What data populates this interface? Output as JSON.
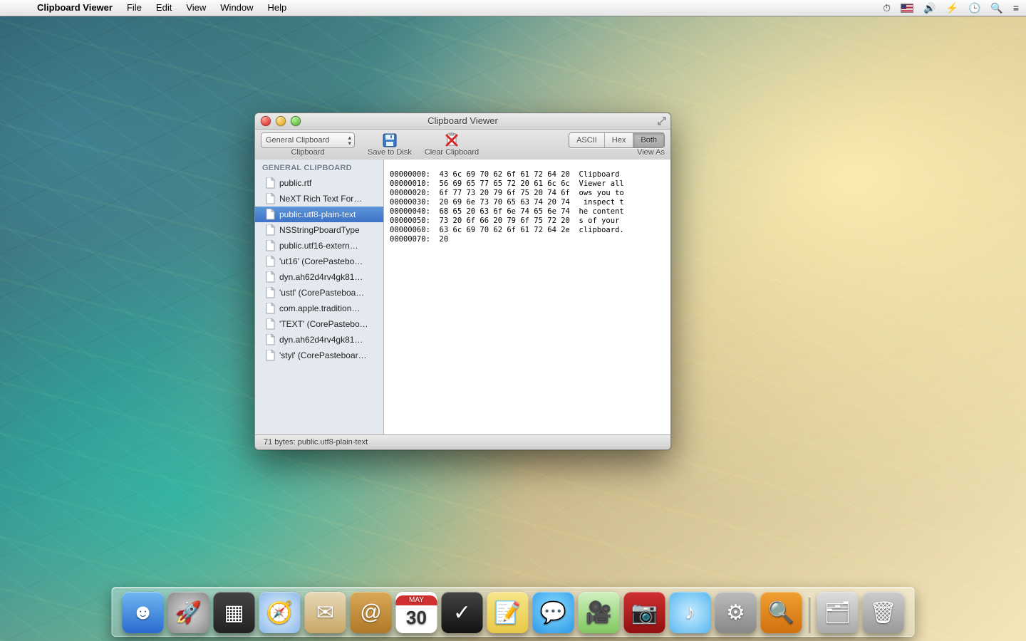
{
  "menubar": {
    "app_name": "Clipboard Viewer",
    "items": [
      "File",
      "Edit",
      "View",
      "Window",
      "Help"
    ],
    "extras": [
      "timer-icon",
      "flag-us",
      "volume-icon",
      "battery-icon",
      "clock-icon",
      "spotlight-icon",
      "notifications-icon"
    ]
  },
  "window": {
    "title": "Clipboard Viewer",
    "toolbar": {
      "clipboard_popup": "General Clipboard",
      "clipboard_label": "Clipboard",
      "save_label": "Save to Disk",
      "clear_label": "Clear Clipboard",
      "viewas_label": "View As",
      "segments": [
        "ASCII",
        "Hex",
        "Both"
      ],
      "segment_selected": 2
    },
    "sidebar": {
      "header": "GENERAL CLIPBOARD",
      "items": [
        "public.rtf",
        "NeXT Rich Text For…",
        "public.utf8-plain-text",
        "NSStringPboardType",
        "public.utf16-extern…",
        "'ut16' (CorePastebo…",
        "dyn.ah62d4rv4gk81…",
        "'ustl' (CorePasteboa…",
        "com.apple.tradition…",
        "'TEXT' (CorePastebo…",
        "dyn.ah62d4rv4gk81…",
        "'styl' (CorePasteboar…"
      ],
      "selected": 2
    },
    "hex_lines": [
      "00000000:  43 6c 69 70 62 6f 61 72 64 20  Clipboard ",
      "00000010:  56 69 65 77 65 72 20 61 6c 6c  Viewer all",
      "00000020:  6f 77 73 20 79 6f 75 20 74 6f  ows you to",
      "00000030:  20 69 6e 73 70 65 63 74 20 74   inspect t",
      "00000040:  68 65 20 63 6f 6e 74 65 6e 74  he content",
      "00000050:  73 20 6f 66 20 79 6f 75 72 20  s of your ",
      "00000060:  63 6c 69 70 62 6f 61 72 64 2e  clipboard.",
      "00000070:  20                              "
    ],
    "status": "71 bytes: public.utf8-plain-text"
  },
  "dock": {
    "cal_month": "MAY",
    "cal_day": "30",
    "items": [
      "finder",
      "launchpad",
      "mission-control",
      "safari",
      "mail",
      "contacts",
      "calendar",
      "reminders",
      "notes",
      "messages",
      "facetime",
      "photobooth",
      "itunes",
      "system-preferences",
      "preview"
    ],
    "right_items": [
      "documents",
      "trash"
    ]
  }
}
